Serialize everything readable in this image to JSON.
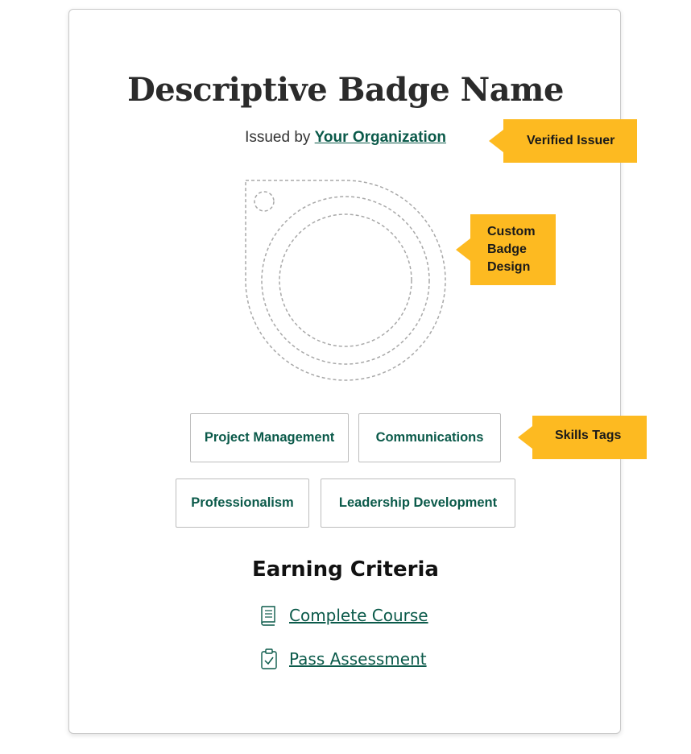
{
  "badge": {
    "title": "Descriptive Badge Name",
    "issued_prefix": "Issued by",
    "issuer_link": "Your Organization"
  },
  "skills": [
    "Project Management",
    "Communications",
    "Professionalism",
    "Leadership Development"
  ],
  "criteria": {
    "heading": "Earning Criteria",
    "items": [
      {
        "label": "Complete Course",
        "icon": "book-icon"
      },
      {
        "label": "Pass Assessment",
        "icon": "clipboard-check-icon"
      }
    ]
  },
  "callouts": {
    "issuer": "Verified Issuer",
    "design_line1": "Custom",
    "design_line2": "Badge",
    "design_line3": "Design",
    "skills": "Skills Tags"
  },
  "colors": {
    "accent_green": "#0b5a4a",
    "callout_yellow": "#fdba21"
  }
}
